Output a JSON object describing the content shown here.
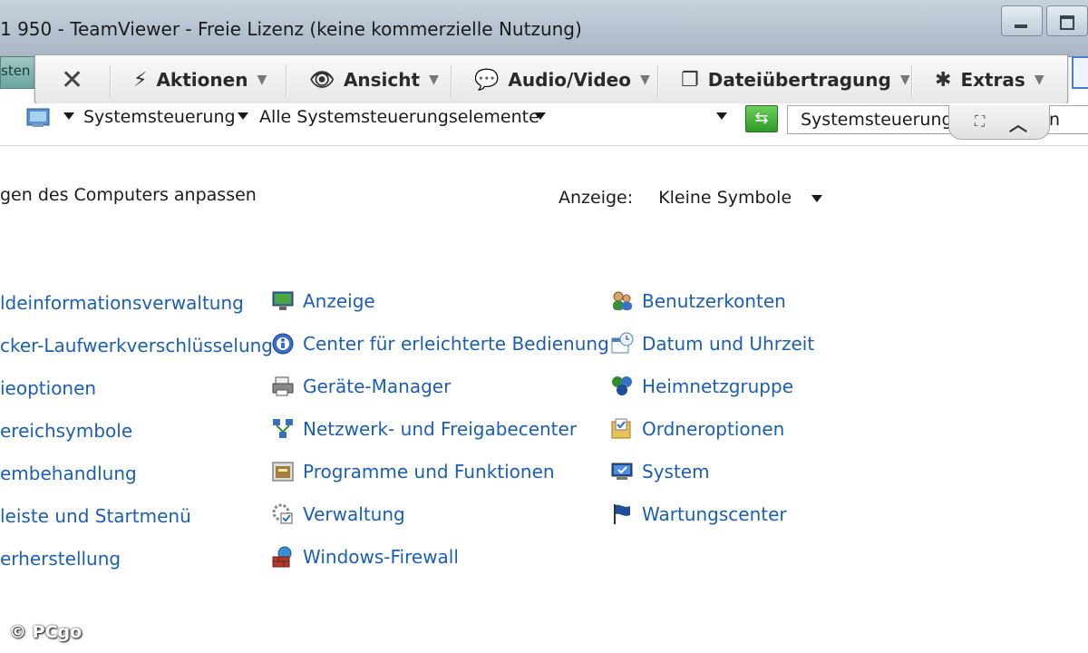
{
  "window": {
    "title": "1 950 - TeamViewer - Freie Lizenz (keine kommerzielle Nutzung)"
  },
  "left_tab": {
    "label": "sten"
  },
  "teamviewer_toolbar": {
    "items": [
      {
        "label": "Aktionen",
        "icon": "lightning-icon"
      },
      {
        "label": "Ansicht",
        "icon": "eye-icon"
      },
      {
        "label": "Audio/Video",
        "icon": "chat-bubbles-icon"
      },
      {
        "label": "Dateiübertragung",
        "icon": "documents-icon"
      },
      {
        "label": "Extras",
        "icon": "puzzle-icon"
      }
    ]
  },
  "address_bar": {
    "breadcrumbs": [
      "Systemsteuerung",
      "Alle Systemsteuerungselemente"
    ],
    "search_value": "Systemsteuerung",
    "search_trailing": "n"
  },
  "main": {
    "heading": "gen des Computers anpassen",
    "view_label": "Anzeige:",
    "view_value": "Kleine Symbole",
    "columns": [
      [
        "ldeinformationsverwaltung",
        "cker-Laufwerkverschlüsselung",
        "ieoptionen",
        "ereichsymbole",
        "embehandlung",
        "leiste und Startmenü",
        "erherstellung"
      ],
      [
        "Anzeige",
        "Center für erleichterte Bedienung",
        "Geräte-Manager",
        "Netzwerk- und Freigabecenter",
        "Programme und Funktionen",
        "Verwaltung",
        "Windows-Firewall"
      ],
      [
        "Benutzerkonten",
        "Datum und Uhrzeit",
        "Heimnetzgruppe",
        "Ordneroptionen",
        "System",
        "Wartungscenter"
      ]
    ]
  },
  "watermark": "© PCgo",
  "colors": {
    "link": "#1a5fb4",
    "titlebar": "#b9c5d2"
  }
}
